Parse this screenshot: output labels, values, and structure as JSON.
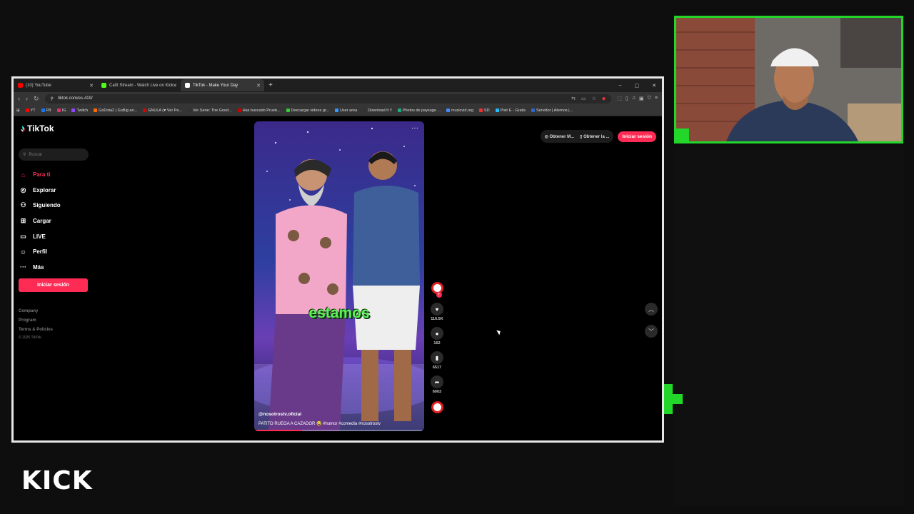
{
  "browser": {
    "tabs": [
      {
        "title": "(10) YouTube",
        "color": "#ff0000"
      },
      {
        "title": "Ca0t Stream - Watch Live on Kick",
        "color": "#53fc18"
      },
      {
        "title": "TikTok - Make Your Day",
        "color": "#ffffff"
      }
    ],
    "new_tab": "+",
    "url": "tiktok.com/es-419/",
    "bookmarks": [
      {
        "label": "YT",
        "color": "#ff0000"
      },
      {
        "label": "FB",
        "color": "#1877f2"
      },
      {
        "label": "IG",
        "color": "#e1306c"
      },
      {
        "label": "Twitch",
        "color": "#9146ff"
      },
      {
        "label": "GoDota2 | GoBig an...",
        "color": "#ff6a00"
      },
      {
        "label": "GNULA (♥ Ver Pe...",
        "color": "#d00"
      },
      {
        "label": "Ver Serie: The Good...",
        "color": "#333"
      },
      {
        "label": "Has buscado Prueb...",
        "color": "#c00"
      },
      {
        "label": "Descargar videos gr...",
        "color": "#3c3"
      },
      {
        "label": "User area",
        "color": "#39f"
      },
      {
        "label": "Download It !!",
        "color": "#333"
      },
      {
        "label": "Photos de paysage ...",
        "color": "#2a8"
      },
      {
        "label": "musicvid.org",
        "color": "#48f"
      },
      {
        "label": "SD",
        "color": "#e33"
      },
      {
        "label": "Pixlr E - Gratis",
        "color": "#2bf"
      },
      {
        "label": "Servidor | Aternos |...",
        "color": "#36c"
      }
    ]
  },
  "tiktok": {
    "logo": "TikTok",
    "search_placeholder": "Buscar",
    "nav": [
      {
        "label": "Para ti",
        "icon": "home-icon",
        "glyph": "⌂",
        "active": true
      },
      {
        "label": "Explorar",
        "icon": "compass-icon",
        "glyph": "◎",
        "active": false
      },
      {
        "label": "Siguiendo",
        "icon": "following-icon",
        "glyph": "⚇",
        "active": false
      },
      {
        "label": "Cargar",
        "icon": "upload-icon",
        "glyph": "⊞",
        "active": false
      },
      {
        "label": "LIVE",
        "icon": "live-icon",
        "glyph": "▭",
        "active": false
      },
      {
        "label": "Perfil",
        "icon": "profile-icon",
        "glyph": "☺",
        "active": false
      },
      {
        "label": "Más",
        "icon": "more-icon",
        "glyph": "···",
        "active": false
      }
    ],
    "login_button": "Iniciar sesión",
    "footer": [
      "Company",
      "Program",
      "Terms & Policies"
    ],
    "copyright": "© 2025 TikTok",
    "top_actions": [
      "Obtener M...",
      "Obtener la ...",
      "Iniciar sesión"
    ],
    "video": {
      "caption_overlay": "estamos",
      "author": "@nosotrostv.oficial",
      "description": "PATITO RUEGA A CAZADOR 😂 #humor #comedia #nosotrostv",
      "progress": 0.28
    },
    "stats": {
      "likes": "116.5K",
      "comments": "162",
      "saves": "6517",
      "shares": "6003"
    },
    "accent": "#fe2c55"
  },
  "overlay": {
    "brand": "KICK",
    "accent": "#22d62a"
  }
}
